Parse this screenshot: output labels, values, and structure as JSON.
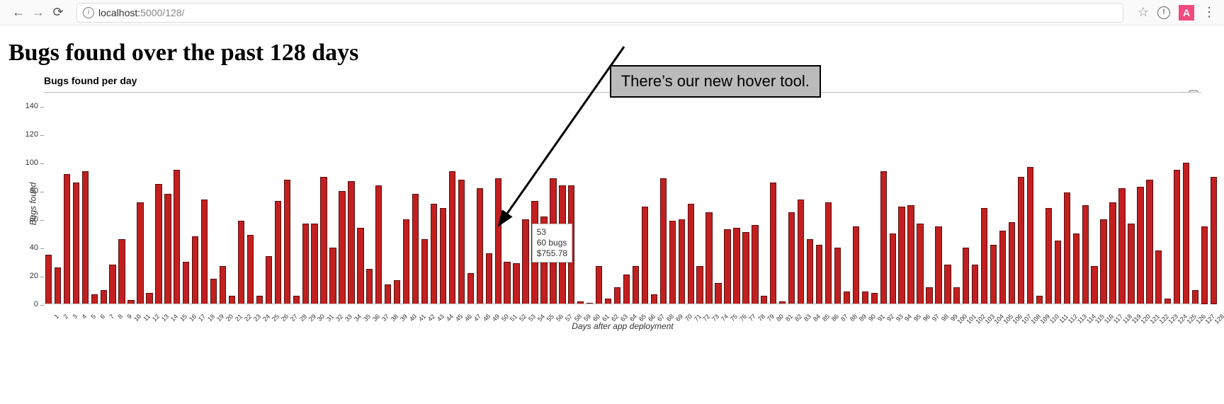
{
  "browser": {
    "url_scheme_host": "localhost:",
    "url_path": "5000/128/",
    "ext_badge": "A"
  },
  "page": {
    "title": "Bugs found over the past 128 days"
  },
  "annotation_text": "There’s our new hover tool.",
  "tooltip": {
    "line1": "53",
    "line2": "60 bugs",
    "line3": "$755.78",
    "at_index": 52
  },
  "chart_data": {
    "type": "bar",
    "title": "Bugs found per day",
    "xlabel": "Days after app deployment",
    "ylabel": "Bugs found",
    "ylim": [
      0,
      150
    ],
    "yticks": [
      0,
      20,
      40,
      60,
      80,
      100,
      120,
      140
    ],
    "categories": [
      1,
      2,
      3,
      4,
      5,
      6,
      7,
      8,
      9,
      10,
      11,
      12,
      13,
      14,
      15,
      16,
      17,
      18,
      19,
      20,
      21,
      22,
      23,
      24,
      25,
      26,
      27,
      28,
      29,
      30,
      31,
      32,
      33,
      34,
      35,
      36,
      37,
      38,
      39,
      40,
      41,
      42,
      43,
      44,
      45,
      46,
      47,
      48,
      49,
      50,
      51,
      52,
      53,
      54,
      55,
      56,
      57,
      58,
      59,
      60,
      61,
      62,
      63,
      64,
      65,
      66,
      67,
      68,
      69,
      70,
      71,
      72,
      73,
      74,
      75,
      76,
      77,
      78,
      79,
      80,
      81,
      82,
      83,
      84,
      85,
      86,
      87,
      88,
      89,
      90,
      91,
      92,
      93,
      94,
      95,
      96,
      97,
      98,
      99,
      100,
      101,
      102,
      103,
      104,
      105,
      106,
      107,
      108,
      109,
      110,
      111,
      112,
      113,
      114,
      115,
      116,
      117,
      118,
      119,
      120,
      121,
      122,
      123,
      124,
      125,
      126,
      127,
      128
    ],
    "values": [
      35,
      26,
      92,
      86,
      94,
      7,
      10,
      28,
      46,
      3,
      72,
      8,
      85,
      78,
      95,
      30,
      48,
      74,
      18,
      27,
      6,
      59,
      49,
      6,
      34,
      73,
      88,
      6,
      57,
      57,
      90,
      40,
      80,
      87,
      54,
      25,
      84,
      14,
      17,
      60,
      78,
      46,
      71,
      68,
      94,
      88,
      22,
      82,
      36,
      89,
      30,
      29,
      60,
      73,
      62,
      89,
      84,
      84,
      2,
      1,
      27,
      4,
      12,
      21,
      27,
      69,
      7,
      89,
      59,
      60,
      71,
      27,
      65,
      15,
      53,
      54,
      51,
      56,
      6,
      86,
      2,
      65,
      74,
      46,
      42,
      72,
      40,
      9,
      55,
      9,
      8,
      94,
      50,
      69,
      70,
      57,
      12,
      55,
      28,
      12,
      40,
      28,
      68,
      42,
      52,
      58,
      90,
      97,
      6,
      68,
      45,
      79,
      50,
      70,
      27,
      60,
      72,
      82,
      57,
      83,
      88,
      38,
      4,
      95,
      100,
      10,
      55,
      90
    ]
  }
}
